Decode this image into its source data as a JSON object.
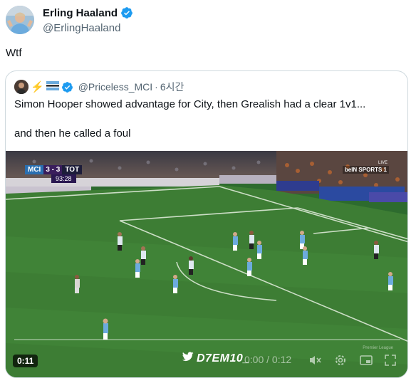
{
  "author": {
    "display_name": "Erling Haaland",
    "handle": "@ErlingHaaland",
    "verified": true
  },
  "tweet": {
    "text": "Wtf"
  },
  "quote": {
    "emoji": "⚡",
    "handle": "@Priceless_MCI",
    "separator": "·",
    "time": "6시간",
    "line1": "Simon Hooper showed advantage for City, then Grealish had a clear 1v1...",
    "line2": "and then he called a foul"
  },
  "video": {
    "scorebug": {
      "home": "MCI",
      "score": "3 - 3",
      "away": "TOT",
      "clock": "93:28"
    },
    "broadcaster": "beIN SPORTS 1",
    "live_label": "LIVE",
    "elapsed_badge": "0:11",
    "watermark": "D7EM10_",
    "player_time": "0:00 / 0:12",
    "progress": 0,
    "league_logo": "Premier League"
  },
  "colors": {
    "verified_blue": "#1d9bf0",
    "pitch_green": "#3d7d34",
    "text_secondary": "#536471"
  }
}
